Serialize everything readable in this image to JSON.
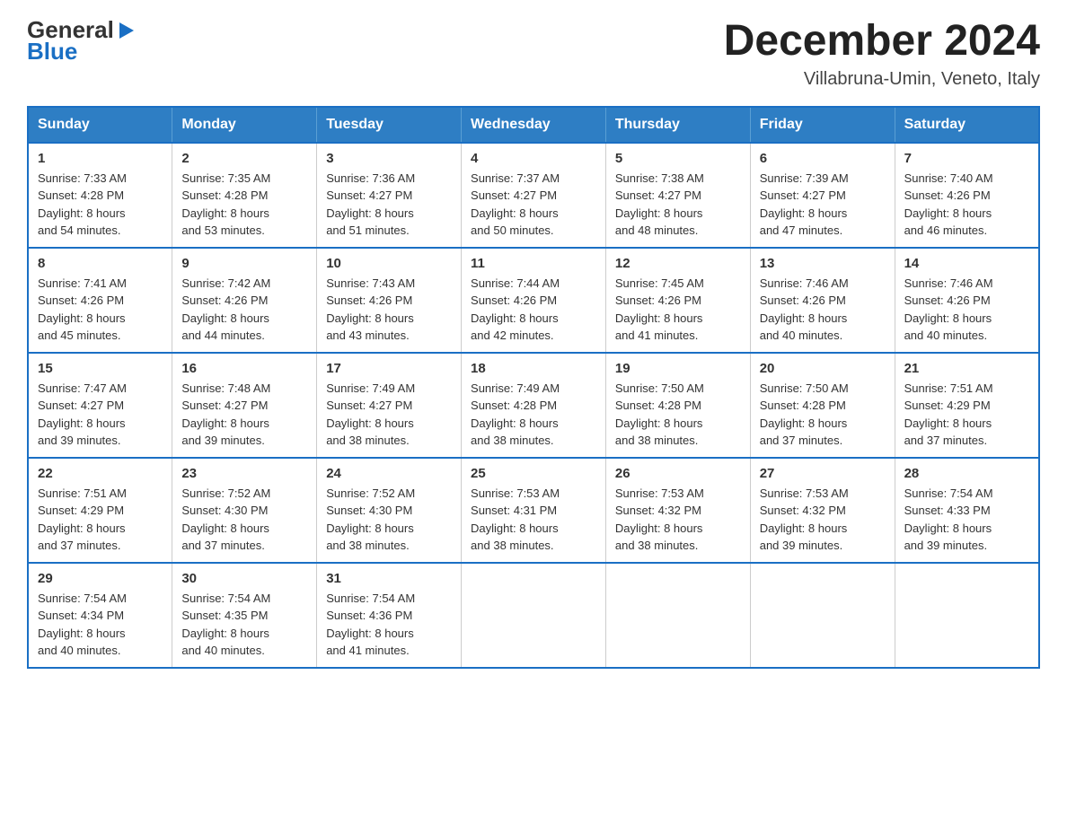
{
  "logo": {
    "line1": "General",
    "arrow": "▶",
    "line2": "Blue"
  },
  "title": "December 2024",
  "subtitle": "Villabruna-Umin, Veneto, Italy",
  "days_of_week": [
    "Sunday",
    "Monday",
    "Tuesday",
    "Wednesday",
    "Thursday",
    "Friday",
    "Saturday"
  ],
  "weeks": [
    [
      {
        "day": 1,
        "sunrise": "7:33 AM",
        "sunset": "4:28 PM",
        "daylight": "8 hours and 54 minutes."
      },
      {
        "day": 2,
        "sunrise": "7:35 AM",
        "sunset": "4:28 PM",
        "daylight": "8 hours and 53 minutes."
      },
      {
        "day": 3,
        "sunrise": "7:36 AM",
        "sunset": "4:27 PM",
        "daylight": "8 hours and 51 minutes."
      },
      {
        "day": 4,
        "sunrise": "7:37 AM",
        "sunset": "4:27 PM",
        "daylight": "8 hours and 50 minutes."
      },
      {
        "day": 5,
        "sunrise": "7:38 AM",
        "sunset": "4:27 PM",
        "daylight": "8 hours and 48 minutes."
      },
      {
        "day": 6,
        "sunrise": "7:39 AM",
        "sunset": "4:27 PM",
        "daylight": "8 hours and 47 minutes."
      },
      {
        "day": 7,
        "sunrise": "7:40 AM",
        "sunset": "4:26 PM",
        "daylight": "8 hours and 46 minutes."
      }
    ],
    [
      {
        "day": 8,
        "sunrise": "7:41 AM",
        "sunset": "4:26 PM",
        "daylight": "8 hours and 45 minutes."
      },
      {
        "day": 9,
        "sunrise": "7:42 AM",
        "sunset": "4:26 PM",
        "daylight": "8 hours and 44 minutes."
      },
      {
        "day": 10,
        "sunrise": "7:43 AM",
        "sunset": "4:26 PM",
        "daylight": "8 hours and 43 minutes."
      },
      {
        "day": 11,
        "sunrise": "7:44 AM",
        "sunset": "4:26 PM",
        "daylight": "8 hours and 42 minutes."
      },
      {
        "day": 12,
        "sunrise": "7:45 AM",
        "sunset": "4:26 PM",
        "daylight": "8 hours and 41 minutes."
      },
      {
        "day": 13,
        "sunrise": "7:46 AM",
        "sunset": "4:26 PM",
        "daylight": "8 hours and 40 minutes."
      },
      {
        "day": 14,
        "sunrise": "7:46 AM",
        "sunset": "4:26 PM",
        "daylight": "8 hours and 40 minutes."
      }
    ],
    [
      {
        "day": 15,
        "sunrise": "7:47 AM",
        "sunset": "4:27 PM",
        "daylight": "8 hours and 39 minutes."
      },
      {
        "day": 16,
        "sunrise": "7:48 AM",
        "sunset": "4:27 PM",
        "daylight": "8 hours and 39 minutes."
      },
      {
        "day": 17,
        "sunrise": "7:49 AM",
        "sunset": "4:27 PM",
        "daylight": "8 hours and 38 minutes."
      },
      {
        "day": 18,
        "sunrise": "7:49 AM",
        "sunset": "4:28 PM",
        "daylight": "8 hours and 38 minutes."
      },
      {
        "day": 19,
        "sunrise": "7:50 AM",
        "sunset": "4:28 PM",
        "daylight": "8 hours and 38 minutes."
      },
      {
        "day": 20,
        "sunrise": "7:50 AM",
        "sunset": "4:28 PM",
        "daylight": "8 hours and 37 minutes."
      },
      {
        "day": 21,
        "sunrise": "7:51 AM",
        "sunset": "4:29 PM",
        "daylight": "8 hours and 37 minutes."
      }
    ],
    [
      {
        "day": 22,
        "sunrise": "7:51 AM",
        "sunset": "4:29 PM",
        "daylight": "8 hours and 37 minutes."
      },
      {
        "day": 23,
        "sunrise": "7:52 AM",
        "sunset": "4:30 PM",
        "daylight": "8 hours and 37 minutes."
      },
      {
        "day": 24,
        "sunrise": "7:52 AM",
        "sunset": "4:30 PM",
        "daylight": "8 hours and 38 minutes."
      },
      {
        "day": 25,
        "sunrise": "7:53 AM",
        "sunset": "4:31 PM",
        "daylight": "8 hours and 38 minutes."
      },
      {
        "day": 26,
        "sunrise": "7:53 AM",
        "sunset": "4:32 PM",
        "daylight": "8 hours and 38 minutes."
      },
      {
        "day": 27,
        "sunrise": "7:53 AM",
        "sunset": "4:32 PM",
        "daylight": "8 hours and 39 minutes."
      },
      {
        "day": 28,
        "sunrise": "7:54 AM",
        "sunset": "4:33 PM",
        "daylight": "8 hours and 39 minutes."
      }
    ],
    [
      {
        "day": 29,
        "sunrise": "7:54 AM",
        "sunset": "4:34 PM",
        "daylight": "8 hours and 40 minutes."
      },
      {
        "day": 30,
        "sunrise": "7:54 AM",
        "sunset": "4:35 PM",
        "daylight": "8 hours and 40 minutes."
      },
      {
        "day": 31,
        "sunrise": "7:54 AM",
        "sunset": "4:36 PM",
        "daylight": "8 hours and 41 minutes."
      },
      null,
      null,
      null,
      null
    ]
  ],
  "labels": {
    "sunrise": "Sunrise:",
    "sunset": "Sunset:",
    "daylight": "Daylight:"
  }
}
